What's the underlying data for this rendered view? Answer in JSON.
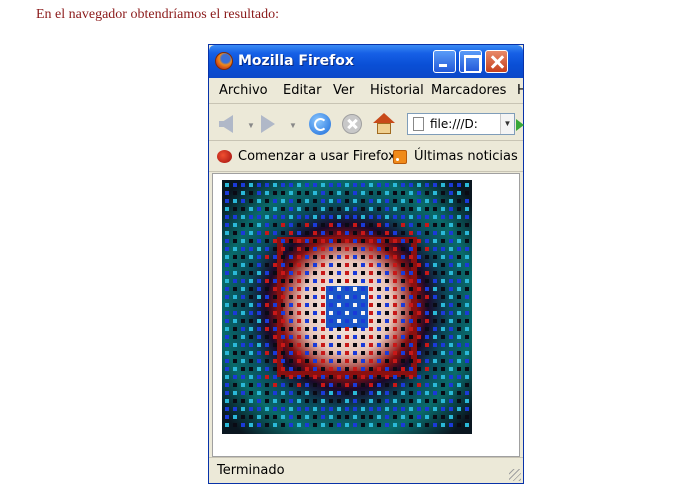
{
  "caption": "En el navegador obtendríamos el resultado:",
  "window": {
    "title": "Mozilla Firefox"
  },
  "menu": [
    "Archivo",
    "Editar",
    "Ver",
    "Historial",
    "Marcadores",
    "H"
  ],
  "navigation": {
    "url": "file:///D:"
  },
  "bookmarks": [
    {
      "label": "Comenzar a usar Firefox",
      "icon": "firefox-start-icon"
    },
    {
      "label": "Últimas noticias",
      "icon": "rss-feed-icon"
    }
  ],
  "status": "Terminado",
  "artwork": {
    "colors": {
      "outer_dark": "#0a1620",
      "teal": "#0a6a6a",
      "red_ring": "#8a1010",
      "center_light": "#f4ece4",
      "blue_square": "#1a56c8"
    }
  }
}
